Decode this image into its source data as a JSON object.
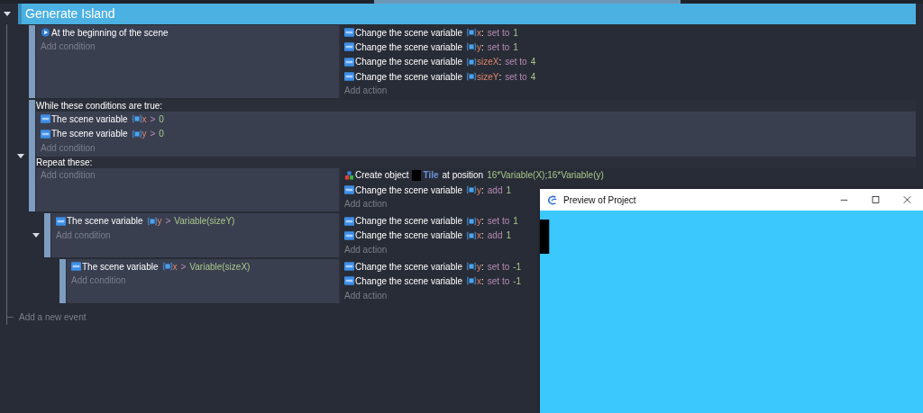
{
  "group": {
    "title": "Generate Island",
    "expanded": true
  },
  "events": [
    {
      "kind": "standard",
      "conditions": [
        {
          "kind": "start",
          "parts": [
            {
              "kind": "text",
              "text": "At the beginning of the scene"
            }
          ]
        }
      ],
      "add_condition": "Add condition",
      "actions": [
        {
          "kind": "variable",
          "parts": [
            {
              "kind": "text",
              "text": "Change the scene variable"
            },
            {
              "kind": "var",
              "text": "x"
            },
            {
              "kind": "punct",
              "text": ":"
            },
            {
              "kind": "op",
              "text": "set to"
            },
            {
              "kind": "value",
              "text": "1"
            }
          ]
        },
        {
          "kind": "variable",
          "parts": [
            {
              "kind": "text",
              "text": "Change the scene variable"
            },
            {
              "kind": "var",
              "text": "y"
            },
            {
              "kind": "punct",
              "text": ":"
            },
            {
              "kind": "op",
              "text": "set to"
            },
            {
              "kind": "value",
              "text": "1"
            }
          ]
        },
        {
          "kind": "variable",
          "parts": [
            {
              "kind": "text",
              "text": "Change the scene variable"
            },
            {
              "kind": "var",
              "text": "sizeX"
            },
            {
              "kind": "punct",
              "text": ":"
            },
            {
              "kind": "op",
              "text": "set to"
            },
            {
              "kind": "value",
              "text": "4"
            }
          ]
        },
        {
          "kind": "variable",
          "parts": [
            {
              "kind": "text",
              "text": "Change the scene variable"
            },
            {
              "kind": "var",
              "text": "sizeY"
            },
            {
              "kind": "punct",
              "text": ":"
            },
            {
              "kind": "op",
              "text": "set to"
            },
            {
              "kind": "value",
              "text": "4"
            }
          ]
        }
      ],
      "add_action": "Add action"
    },
    {
      "kind": "while",
      "expanded": true,
      "while_label": "While these conditions are true:",
      "while_conditions": [
        {
          "kind": "variable",
          "parts": [
            {
              "kind": "text",
              "text": "The scene variable"
            },
            {
              "kind": "var",
              "text": "x"
            },
            {
              "kind": "op",
              "text": ">"
            },
            {
              "kind": "value",
              "text": "0"
            }
          ]
        },
        {
          "kind": "variable",
          "parts": [
            {
              "kind": "text",
              "text": "The scene variable"
            },
            {
              "kind": "var",
              "text": "y"
            },
            {
              "kind": "op",
              "text": ">"
            },
            {
              "kind": "value",
              "text": "0"
            }
          ]
        }
      ],
      "add_while_condition": "Add condition",
      "repeat_label": "Repeat these:",
      "add_condition": "Add condition",
      "actions": [
        {
          "kind": "create",
          "parts": [
            {
              "kind": "text",
              "text": "Create object"
            },
            {
              "kind": "object",
              "text": "Tile"
            },
            {
              "kind": "text",
              "text": "at position"
            },
            {
              "kind": "value",
              "text": "16*Variable(X);16*Variable(y)"
            }
          ]
        },
        {
          "kind": "variable",
          "parts": [
            {
              "kind": "text",
              "text": "Change the scene variable"
            },
            {
              "kind": "var",
              "text": "y"
            },
            {
              "kind": "punct",
              "text": ":"
            },
            {
              "kind": "op",
              "text": "add"
            },
            {
              "kind": "value",
              "text": "1"
            }
          ]
        }
      ],
      "add_action": "Add action",
      "subevents": [
        {
          "kind": "standard",
          "expanded": true,
          "conditions": [
            {
              "kind": "variable",
              "parts": [
                {
                  "kind": "text",
                  "text": "The scene variable"
                },
                {
                  "kind": "var",
                  "text": "y"
                },
                {
                  "kind": "op",
                  "text": ">"
                },
                {
                  "kind": "value",
                  "text": "Variable(sizeY)"
                }
              ]
            }
          ],
          "add_condition": "Add condition",
          "actions": [
            {
              "kind": "variable",
              "parts": [
                {
                  "kind": "text",
                  "text": "Change the scene variable"
                },
                {
                  "kind": "var",
                  "text": "y"
                },
                {
                  "kind": "punct",
                  "text": ":"
                },
                {
                  "kind": "op",
                  "text": "set to"
                },
                {
                  "kind": "value",
                  "text": "1"
                }
              ]
            },
            {
              "kind": "variable",
              "parts": [
                {
                  "kind": "text",
                  "text": "Change the scene variable"
                },
                {
                  "kind": "var",
                  "text": "x"
                },
                {
                  "kind": "punct",
                  "text": ":"
                },
                {
                  "kind": "op",
                  "text": "add"
                },
                {
                  "kind": "value",
                  "text": "1"
                }
              ]
            }
          ],
          "add_action": "Add action",
          "subevents": [
            {
              "kind": "standard",
              "conditions": [
                {
                  "kind": "variable",
                  "parts": [
                    {
                      "kind": "text",
                      "text": "The scene variable"
                    },
                    {
                      "kind": "var",
                      "text": "x"
                    },
                    {
                      "kind": "op",
                      "text": ">"
                    },
                    {
                      "kind": "value",
                      "text": "Variable(sizeX)"
                    }
                  ]
                }
              ],
              "add_condition": "Add condition",
              "actions": [
                {
                  "kind": "variable",
                  "parts": [
                    {
                      "kind": "text",
                      "text": "Change the scene variable"
                    },
                    {
                      "kind": "var",
                      "text": "y"
                    },
                    {
                      "kind": "punct",
                      "text": ":"
                    },
                    {
                      "kind": "op",
                      "text": "set to"
                    },
                    {
                      "kind": "value",
                      "text": "-1"
                    }
                  ]
                },
                {
                  "kind": "variable",
                  "parts": [
                    {
                      "kind": "text",
                      "text": "Change the scene variable"
                    },
                    {
                      "kind": "var",
                      "text": "x"
                    },
                    {
                      "kind": "punct",
                      "text": ":"
                    },
                    {
                      "kind": "op",
                      "text": "set to"
                    },
                    {
                      "kind": "value",
                      "text": "-1"
                    }
                  ]
                }
              ],
              "add_action": "Add action"
            }
          ]
        }
      ]
    }
  ],
  "add_event": "Add a new event",
  "preview": {
    "title": "Preview of Project"
  }
}
